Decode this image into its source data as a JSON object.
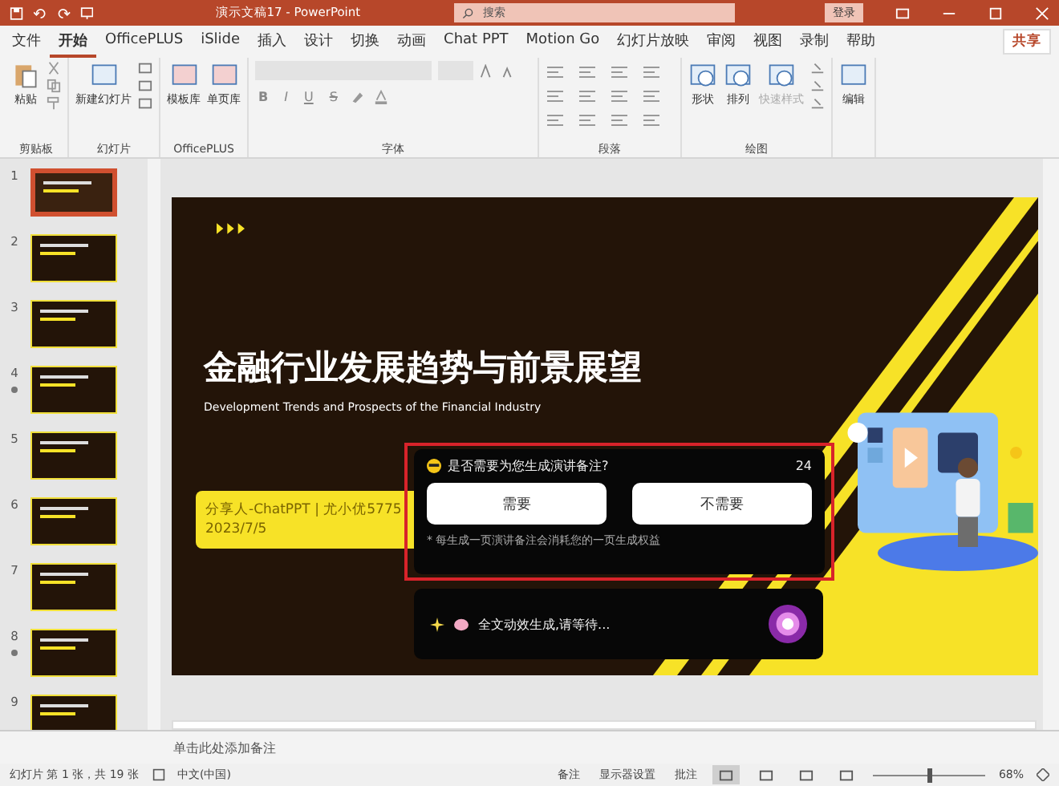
{
  "window": {
    "title": "演示文稿17 - PowerPoint",
    "search_placeholder": "搜索",
    "login": "登录"
  },
  "tabs": [
    {
      "label": "文件",
      "selected": false
    },
    {
      "label": "开始",
      "selected": true
    },
    {
      "label": "OfficePLUS",
      "selected": false
    },
    {
      "label": "iSlide",
      "selected": false
    },
    {
      "label": "插入",
      "selected": false
    },
    {
      "label": "设计",
      "selected": false
    },
    {
      "label": "切换",
      "selected": false
    },
    {
      "label": "动画",
      "selected": false
    },
    {
      "label": "Chat PPT",
      "selected": false
    },
    {
      "label": "Motion Go",
      "selected": false
    },
    {
      "label": "幻灯片放映",
      "selected": false
    },
    {
      "label": "审阅",
      "selected": false
    },
    {
      "label": "视图",
      "selected": false
    },
    {
      "label": "录制",
      "selected": false
    },
    {
      "label": "帮助",
      "selected": false
    }
  ],
  "share": "共享",
  "ribbon": [
    {
      "kind": "clipboard",
      "label": "剪贴板",
      "buttons": [
        {
          "label": "粘贴",
          "disabled": false
        }
      ]
    },
    {
      "kind": "slides",
      "label": "幻灯片",
      "buttons": [
        {
          "label": "新建幻灯片",
          "disabled": false
        }
      ]
    },
    {
      "kind": "plugin",
      "label": "OfficePLUS",
      "buttons": [
        {
          "label": "模板库",
          "disabled": false
        },
        {
          "label": "单页库",
          "disabled": false
        }
      ]
    },
    {
      "kind": "font",
      "label": "字体",
      "buttons": [
        {
          "label": "B",
          "disabled": false
        },
        {
          "label": "I",
          "disabled": false
        },
        {
          "label": "U",
          "disabled": false
        },
        {
          "label": "S",
          "disabled": false
        }
      ]
    },
    {
      "kind": "paragraph",
      "label": "段落"
    },
    {
      "kind": "drawing",
      "label": "绘图",
      "buttons": [
        {
          "label": "形状",
          "disabled": false
        },
        {
          "label": "排列",
          "disabled": false
        },
        {
          "label": "快速样式",
          "disabled": true
        }
      ]
    },
    {
      "kind": "editing",
      "buttons": [
        {
          "label": "编辑",
          "disabled": false
        }
      ]
    }
  ],
  "thumbnails": [
    {
      "number": "1",
      "selected": true,
      "animated": false
    },
    {
      "number": "2",
      "selected": false,
      "animated": false
    },
    {
      "number": "3",
      "selected": false,
      "animated": false
    },
    {
      "number": "4",
      "selected": false,
      "animated": true
    },
    {
      "number": "5",
      "selected": false,
      "animated": false
    },
    {
      "number": "6",
      "selected": false,
      "animated": false
    },
    {
      "number": "7",
      "selected": false,
      "animated": false
    },
    {
      "number": "8",
      "selected": false,
      "animated": true
    },
    {
      "number": "9",
      "selected": false,
      "animated": false
    }
  ],
  "slide": {
    "title": "金融行业发展趋势与前景展望",
    "subtitle": "Development Trends and Prospects of the Financial Industry",
    "presenter": "分享人-ChatPPT | 尤小优5775",
    "date": "2023/7/5"
  },
  "notes_prompt": {
    "question": "是否需要为您生成演讲备注?",
    "countdown": "24",
    "buttons": [
      "需要",
      "不需要"
    ],
    "hint": "* 每生成一页演讲备注会消耗您的一页生成权益"
  },
  "progress_card": {
    "message": "全文动效生成,请等待..."
  },
  "notes_placeholder": "单击此处添加备注",
  "status_bar": {
    "slide_info": "幻灯片 第 1 张，共 19 张",
    "language": "中文(中国)",
    "notes": "备注",
    "display": "显示器设置",
    "comments": "批注",
    "views": [
      {
        "selected": true
      },
      {
        "selected": false
      },
      {
        "selected": false
      },
      {
        "selected": false
      }
    ],
    "zoom": {
      "level": 0.5,
      "reading": "68%"
    }
  }
}
